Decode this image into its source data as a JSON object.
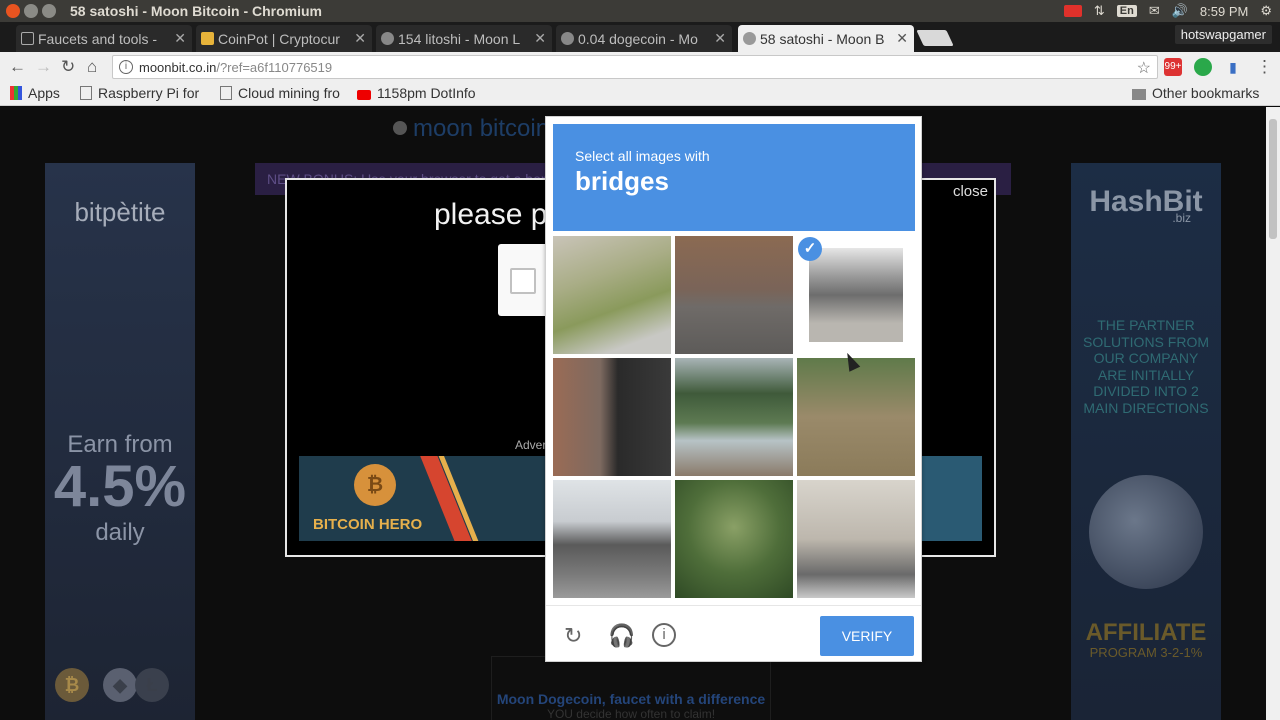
{
  "window": {
    "title": "58 satoshi - Moon Bitcoin - Chromium"
  },
  "tray": {
    "lang": "En",
    "volume": "🔊",
    "time": "8:59 PM"
  },
  "tabs": [
    {
      "label": "Faucets and tools -",
      "active": false
    },
    {
      "label": "CoinPot | Cryptocur",
      "active": false
    },
    {
      "label": "154 litoshi - Moon L",
      "active": false
    },
    {
      "label": "0.04 dogecoin - Mo",
      "active": false
    },
    {
      "label": "58 satoshi - Moon B",
      "active": true
    }
  ],
  "profile": "hotswapgamer",
  "address": {
    "host": "moonbit.co.in",
    "path": "/?ref=a6f110776519"
  },
  "extensions": {
    "badge": "99+"
  },
  "bookmarks": [
    {
      "label": "Apps"
    },
    {
      "label": "Raspberry Pi for"
    },
    {
      "label": "Cloud mining fro"
    },
    {
      "label": "1158pm DotInfo"
    }
  ],
  "other_bookmarks": "Other bookmarks",
  "page": {
    "brand": "moon bitcoin",
    "bonus_text": "NEW BONUS: Use your browser to get a bonus for details",
    "claim": {
      "heading": "please pr",
      "close": "close",
      "advert_label": "Advert"
    },
    "hero_ad": {
      "text": "BITCOIN HERO"
    },
    "left_ad": {
      "logo": "bitpètite",
      "earn": "Earn from",
      "percent": "4.5%",
      "daily": "daily"
    },
    "right_ad": {
      "logo": "HashBit",
      "logo_suffix": ".biz",
      "partner_text": "THE PARTNER SOLUTIONS FROM OUR COMPANY ARE INITIALLY DIVIDED INTO 2 MAIN DIRECTIONS",
      "affiliate": "AFFILIATE",
      "program": "PROGRAM 3-2-1%"
    },
    "moondoge": {
      "line1": "Moon Dogecoin, faucet with a difference",
      "line2": "YOU decide how often to claim!"
    }
  },
  "captcha": {
    "instruction": "Select all images with",
    "target": "bridges",
    "tiles": [
      {
        "name": "tile-1",
        "selected": false
      },
      {
        "name": "tile-2",
        "selected": false
      },
      {
        "name": "tile-3",
        "selected": true
      },
      {
        "name": "tile-4",
        "selected": false
      },
      {
        "name": "tile-5",
        "selected": false
      },
      {
        "name": "tile-6",
        "selected": false
      },
      {
        "name": "tile-7",
        "selected": false
      },
      {
        "name": "tile-8",
        "selected": false
      },
      {
        "name": "tile-9",
        "selected": false
      }
    ],
    "verify_label": "VERIFY"
  }
}
